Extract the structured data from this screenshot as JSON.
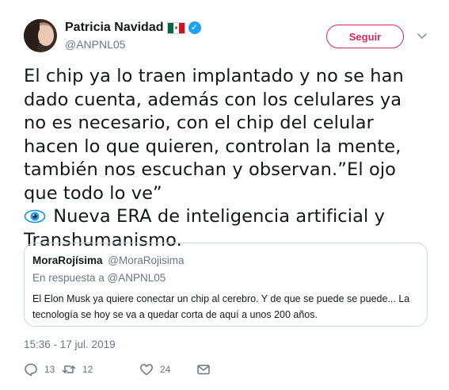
{
  "author": {
    "display_name": "Patricia Navidad",
    "handle": "@ANPNL05",
    "verified": true
  },
  "follow_button": {
    "label": "Seguir",
    "color": "#e0245e"
  },
  "tweet": {
    "text_main": "El chip ya lo traen implantado y no se han dado cuenta, además con los celulares ya no es necesario, con el chip del celular hacen lo que quieren, controlan la mente, también nos escuchan y observan.”El ojo que todo lo ve”",
    "text_after_emoji": " Nueva ERA de inteligencia artificial y Transhumanismo.",
    "timestamp": "15:36 - 17 jul. 2019"
  },
  "quoted_tweet": {
    "display_name": "MoraRojísima",
    "handle": "@MoraRojisima",
    "reply_context": "En respuesta a @ANPNL05",
    "text": "El Elon Musk ya quiere conectar un chip al cerebro. Y de que se puede se puede... La tecnología se hoy se va a quedar corta de aquí a unos 200 años."
  },
  "actions": {
    "replies": "13",
    "retweets": "12",
    "likes": "24"
  },
  "icons": {
    "reply": "reply-icon",
    "retweet": "retweet-icon",
    "like": "heart-icon",
    "message": "envelope-icon",
    "menu": "chevron-down-icon",
    "verified": "verified-badge-icon",
    "flag": "mexico-flag-icon",
    "eye": "eye-emoji-icon"
  },
  "colors": {
    "verified": "#1da1f2",
    "muted": "#657786",
    "border": "#ccd6dd"
  }
}
